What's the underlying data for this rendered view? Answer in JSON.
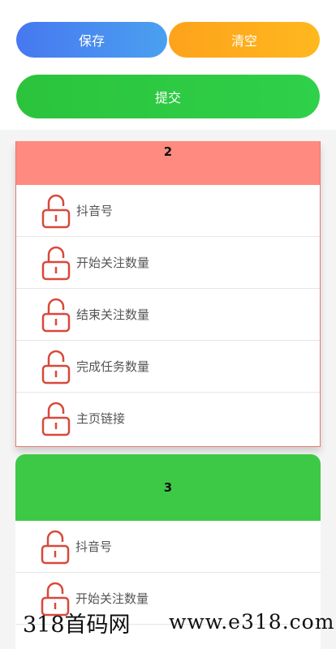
{
  "buttons": {
    "save": "保存",
    "clear": "清空",
    "submit": "提交"
  },
  "cards": [
    {
      "title": "2",
      "fields": [
        "抖音号",
        "开始关注数量",
        "结束关注数量",
        "完成任务数量",
        "主页链接"
      ]
    },
    {
      "title": "3",
      "fields": [
        "抖音号",
        "开始关注数量"
      ]
    }
  ],
  "icons": {
    "field_icon": "lock-icon"
  },
  "colors": {
    "save": "#4a7cf0",
    "clear": "#fea51c",
    "submit": "#2ec640",
    "card2_header": "#ff8a80",
    "card3_header": "#3dc945",
    "lock": "#d9483b"
  },
  "watermark": {
    "brand": "318首码网",
    "url": "www.e318.com"
  }
}
